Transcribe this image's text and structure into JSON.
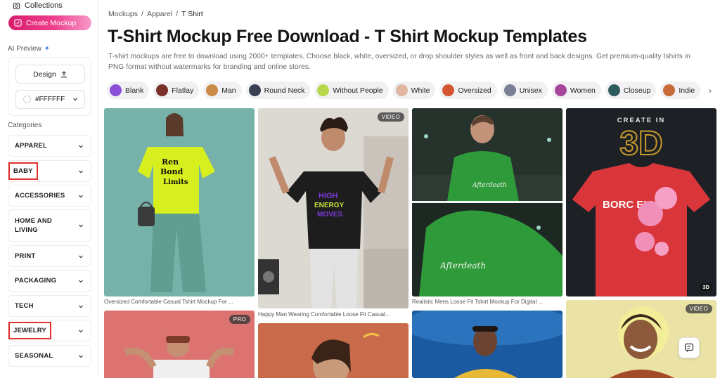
{
  "sidebar": {
    "collections_label": "Collections",
    "create_label": "Create Mockup",
    "ai_preview_label": "AI Preview",
    "design_label": "Design",
    "color_value": "#FFFFFF",
    "categories_title": "Categories",
    "categories": [
      {
        "label": "APPAREL",
        "highlighted": false
      },
      {
        "label": "BABY",
        "highlighted": true
      },
      {
        "label": "ACCESSORIES",
        "highlighted": false
      },
      {
        "label": "HOME AND LIVING",
        "highlighted": false
      },
      {
        "label": "PRINT",
        "highlighted": false
      },
      {
        "label": "PACKAGING",
        "highlighted": false
      },
      {
        "label": "TECH",
        "highlighted": false
      },
      {
        "label": "JEWELRY",
        "highlighted": true
      },
      {
        "label": "SEASONAL",
        "highlighted": false
      }
    ]
  },
  "breadcrumb": [
    "Mockups",
    "/",
    "Apparel",
    "/",
    "T Shirt"
  ],
  "page_title": "T-Shirt Mockup Free Download - T Shirt Mockup Templates",
  "description": "T-shirt mockups are free to download using 2000+ templates. Choose black, white, oversized, or drop shoulder styles as well as front and back designs. Get premium-quality tshirts in PNG format without watermarks for branding and online stores.",
  "chips": [
    {
      "label": "Blank",
      "color": "#8a4fd6"
    },
    {
      "label": "Flatlay",
      "color": "#7a2f2a"
    },
    {
      "label": "Man",
      "color": "#c98a4a"
    },
    {
      "label": "Round Neck",
      "color": "#3a3f52"
    },
    {
      "label": "Without People",
      "color": "#b6d84a"
    },
    {
      "label": "White",
      "color": "#e0b7a0"
    },
    {
      "label": "Oversized",
      "color": "#d4552e"
    },
    {
      "label": "Unisex",
      "color": "#7b7f95"
    },
    {
      "label": "Women",
      "color": "#a7459a"
    },
    {
      "label": "Closeup",
      "color": "#2f5b5c"
    },
    {
      "label": "Indie",
      "color": "#c76b3a"
    }
  ],
  "cards": [
    {
      "caption": "Oversized Comfortable Casual Tshirt Mockup For ...",
      "badge": "",
      "bg": "#79b6ae"
    },
    {
      "caption": "Happy Man Wearing Comfortable Loose Fit Casual...",
      "badge": "VIDEO",
      "bg": "#d9d5d0"
    },
    {
      "caption": "Realistic Mens Loose Fit Tshirt Mockup For Digital ...",
      "badge": "",
      "bg": "#1f2a26"
    },
    {
      "caption": "",
      "badge": "3D",
      "bg": "#1d2126",
      "headline": "CREATE IN",
      "big": "3D",
      "shirt_text": "BORC ELLE"
    },
    {
      "caption": "",
      "badge": "PRO",
      "bg": "#d9726f"
    },
    {
      "caption": "",
      "badge": "",
      "bg": "#c96a4a"
    },
    {
      "caption": "",
      "badge": "",
      "bg": "#1d5e9c"
    },
    {
      "caption": "",
      "badge": "VIDEO",
      "bg": "#e9e2a4"
    }
  ],
  "colors": {
    "accent": "#e8307f",
    "chip_bg": "#f1f1f3",
    "highlight_box": "#e0312c"
  }
}
